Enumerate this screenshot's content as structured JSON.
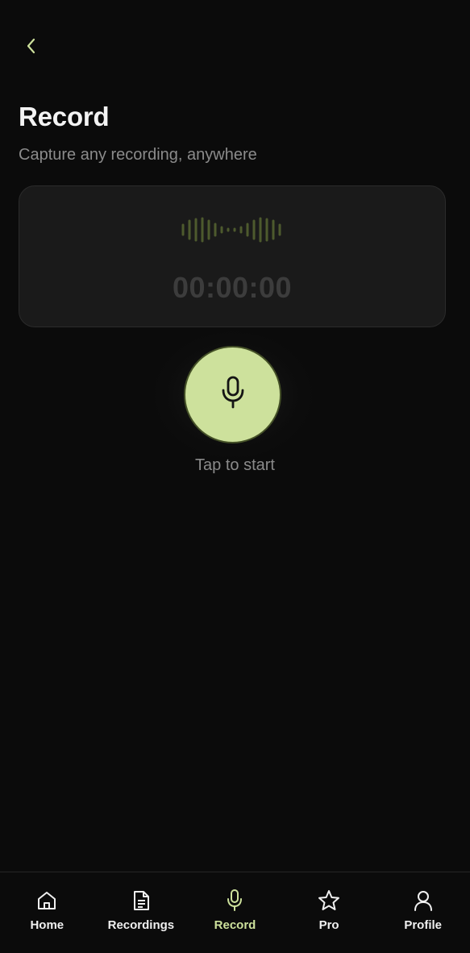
{
  "header": {
    "back_icon": "chevron-left-icon",
    "title": "Record",
    "subtitle": "Capture any recording, anywhere"
  },
  "recorder": {
    "timer": "00:00:00",
    "hint": "Tap to start",
    "mic_icon": "microphone-icon"
  },
  "colors": {
    "accent": "#cde19c",
    "background": "#0b0b0b",
    "card": "#1a1a1a",
    "muted_text": "#8b8b8b"
  },
  "bottom_nav": {
    "items": [
      {
        "label": "Home",
        "icon": "home-icon",
        "active": false
      },
      {
        "label": "Recordings",
        "icon": "document-icon",
        "active": false
      },
      {
        "label": "Record",
        "icon": "microphone-icon",
        "active": true
      },
      {
        "label": "Pro",
        "icon": "star-icon",
        "active": false
      },
      {
        "label": "Profile",
        "icon": "user-icon",
        "active": false
      }
    ]
  }
}
